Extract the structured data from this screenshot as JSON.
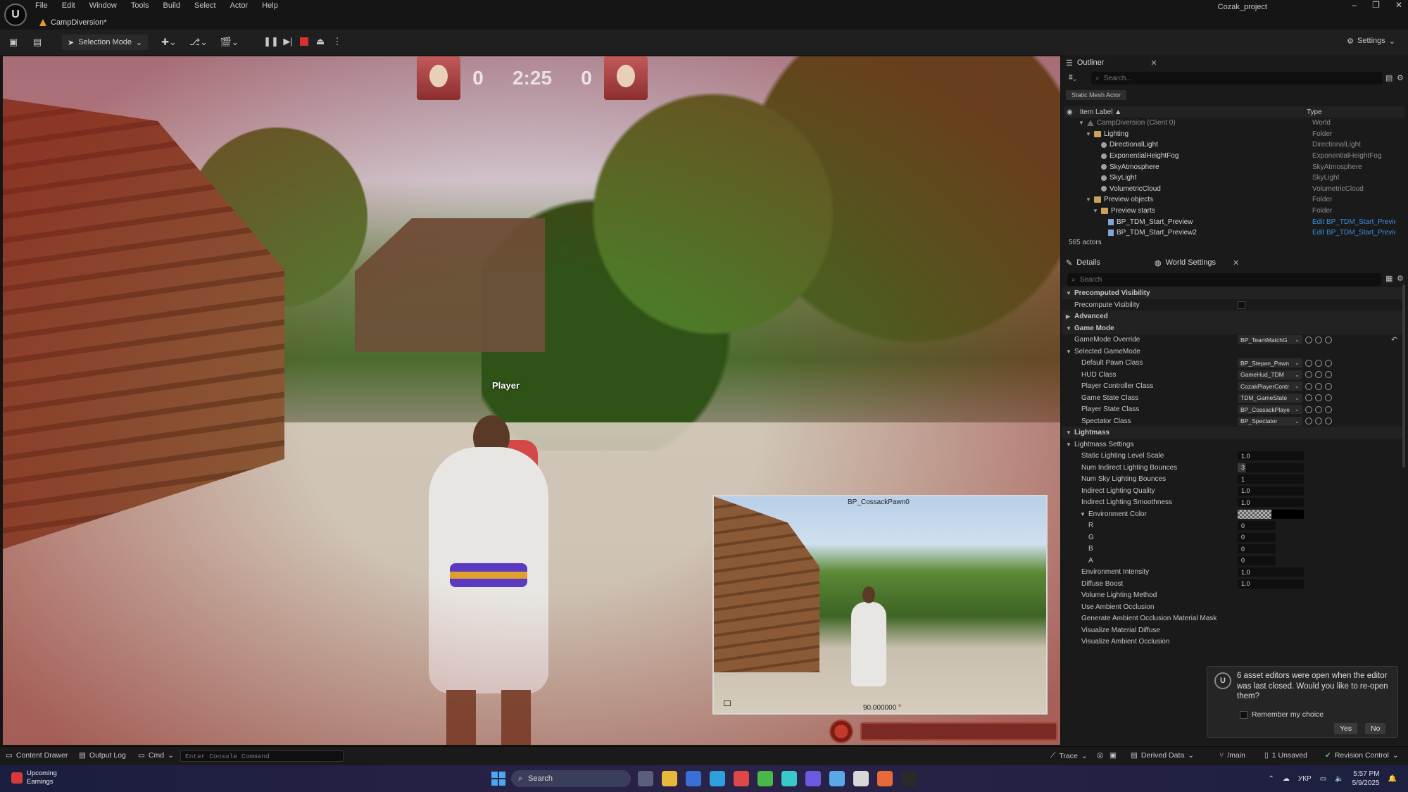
{
  "app": {
    "project_name": "Cozak_project",
    "document_tab": "CampDiversion*",
    "menu": [
      "File",
      "Edit",
      "Window",
      "Tools",
      "Build",
      "Select",
      "Actor",
      "Help"
    ],
    "window_controls": [
      "–",
      "❐",
      "✕"
    ]
  },
  "toolbar": {
    "selection_mode": "Selection Mode",
    "settings_label": "Settings"
  },
  "viewport": {
    "hud": {
      "score_left": "0",
      "timer": "2:25",
      "score_right": "0"
    },
    "player_label": "Player",
    "pip": {
      "title": "BP_CossackPawn0",
      "footer": "90.000000 °"
    }
  },
  "outliner": {
    "tab_label": "Outliner",
    "search_placeholder": "Search...",
    "filter_pill": "Static Mesh Actor",
    "col_label": "Item Label ▲",
    "col_type": "Type",
    "rows": [
      {
        "label": "CampDiversion (Client 0)",
        "type": "World",
        "indent": 2,
        "icon": "world",
        "caret": "▼"
      },
      {
        "label": "Lighting",
        "type": "Folder",
        "indent": 3,
        "icon": "folder",
        "caret": "▼"
      },
      {
        "label": "DirectionalLight",
        "type": "DirectionalLight",
        "indent": 4,
        "icon": "light",
        "caret": ""
      },
      {
        "label": "ExponentialHeightFog",
        "type": "ExponentialHeightFog",
        "indent": 4,
        "icon": "light",
        "caret": ""
      },
      {
        "label": "SkyAtmosphere",
        "type": "SkyAtmosphere",
        "indent": 4,
        "icon": "light",
        "caret": ""
      },
      {
        "label": "SkyLight",
        "type": "SkyLight",
        "indent": 4,
        "icon": "light",
        "caret": ""
      },
      {
        "label": "VolumetricCloud",
        "type": "VolumetricCloud",
        "indent": 4,
        "icon": "light",
        "caret": ""
      },
      {
        "label": "Preview objects",
        "type": "Folder",
        "indent": 3,
        "icon": "folder",
        "caret": "▼"
      },
      {
        "label": "Preview starts",
        "type": "Folder",
        "indent": 4,
        "icon": "folder",
        "caret": "▼"
      },
      {
        "label": "BP_TDM_Start_Preview",
        "type": "Edit BP_TDM_Start_Preview",
        "indent": 5,
        "icon": "bp",
        "caret": "",
        "link": true
      },
      {
        "label": "BP_TDM_Start_Preview2",
        "type": "Edit BP_TDM_Start_Preview",
        "indent": 5,
        "icon": "bp",
        "caret": "",
        "link": true
      }
    ],
    "actor_count": "565 actors"
  },
  "details": {
    "tab_details": "Details",
    "tab_world": "World Settings",
    "search_placeholder": "Search",
    "rows": [
      {
        "kind": "section",
        "label": "Precomputed Visibility",
        "caret": "▼",
        "indent": 0
      },
      {
        "kind": "check",
        "label": "Precompute Visibility",
        "indent": 1
      },
      {
        "kind": "section",
        "label": "Advanced",
        "caret": "▶",
        "indent": 0
      },
      {
        "kind": "section",
        "label": "Game Mode",
        "caret": "▼",
        "indent": 0
      },
      {
        "kind": "dropdown",
        "label": "GameMode Override",
        "value": "BP_TeamMatchG",
        "indent": 1,
        "reset": true
      },
      {
        "kind": "group",
        "label": "Selected GameMode",
        "caret": "▼",
        "indent": 0
      },
      {
        "kind": "dropdown",
        "label": "Default Pawn Class",
        "value": "BP_Stepan_Pawn",
        "indent": 2
      },
      {
        "kind": "dropdown",
        "label": "HUD Class",
        "value": "GameHud_TDM",
        "indent": 2
      },
      {
        "kind": "dropdown",
        "label": "Player Controller Class",
        "value": "CozakPlayerContr",
        "indent": 2
      },
      {
        "kind": "dropdown",
        "label": "Game State Class",
        "value": "TDM_GameState",
        "indent": 2
      },
      {
        "kind": "dropdown",
        "label": "Player State Class",
        "value": "BP_CossackPlaye",
        "indent": 2
      },
      {
        "kind": "dropdown",
        "label": "Spectator Class",
        "value": "BP_Spectator",
        "indent": 2
      },
      {
        "kind": "section",
        "label": "Lightmass",
        "caret": "▼",
        "indent": 0
      },
      {
        "kind": "group",
        "label": "Lightmass Settings",
        "caret": "▼",
        "indent": 0
      },
      {
        "kind": "value",
        "label": "Static Lighting Level Scale",
        "value": "1.0",
        "indent": 2
      },
      {
        "kind": "value",
        "label": "Num Indirect Lighting Bounces",
        "value": "3",
        "indent": 2,
        "slider": true
      },
      {
        "kind": "value",
        "label": "Num Sky Lighting Bounces",
        "value": "1",
        "indent": 2
      },
      {
        "kind": "value",
        "label": "Indirect Lighting Quality",
        "value": "1.0",
        "indent": 2
      },
      {
        "kind": "value",
        "label": "Indirect Lighting Smoothness",
        "value": "1.0",
        "indent": 2
      },
      {
        "kind": "color",
        "label": "Environment Color",
        "caret": "▼",
        "indent": 2
      },
      {
        "kind": "small",
        "label": "R",
        "value": "0",
        "indent": 3
      },
      {
        "kind": "small",
        "label": "G",
        "value": "0",
        "indent": 3
      },
      {
        "kind": "small",
        "label": "B",
        "value": "0",
        "indent": 3
      },
      {
        "kind": "small",
        "label": "A",
        "value": "0",
        "indent": 3
      },
      {
        "kind": "value",
        "label": "Environment Intensity",
        "value": "1.0",
        "indent": 2
      },
      {
        "kind": "value",
        "label": "Diffuse Boost",
        "value": "1.0",
        "indent": 2
      },
      {
        "kind": "label",
        "label": "Volume Lighting Method",
        "indent": 2
      },
      {
        "kind": "label",
        "label": "Use Ambient Occlusion",
        "indent": 2
      },
      {
        "kind": "label",
        "label": "Generate Ambient Occlusion Material Mask",
        "indent": 2
      },
      {
        "kind": "label",
        "label": "Visualize Material Diffuse",
        "indent": 2
      },
      {
        "kind": "label",
        "label": "Visualize Ambient Occlusion",
        "indent": 2
      }
    ]
  },
  "notification": {
    "message": "6 asset editors were open when the editor was last closed. Would you like to re-open them?",
    "remember": "Remember my choice",
    "yes": "Yes",
    "no": "No"
  },
  "statusbar": {
    "content_drawer": "Content Drawer",
    "output_log": "Output Log",
    "cmd": "Cmd",
    "console_placeholder": "Enter Console Command",
    "trace": "Trace",
    "derived_data": "Derived Data",
    "branch": "/main",
    "unsaved": "1 Unsaved",
    "revision_control": "Revision Control"
  },
  "taskbar": {
    "weather_line1": "Upcoming",
    "weather_line2": "Earnings",
    "search": "Search",
    "lang": "УКР",
    "time": "5:57 PM",
    "date": "5/9/2025",
    "app_colors": [
      "#5a5f7a",
      "#e8b83a",
      "#3a6fd8",
      "#2ea0e0",
      "#e04848",
      "#48b848",
      "#3ac8c8",
      "#6a5ae0",
      "#5aa8e8",
      "#d8d8d8",
      "#e86a3a",
      "#2a2a2a"
    ]
  }
}
